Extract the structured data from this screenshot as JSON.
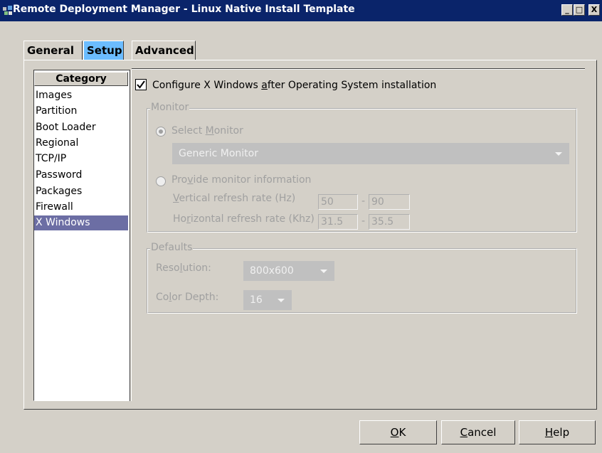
{
  "window": {
    "title": "Remote Deployment Manager - Linux Native Install Template",
    "controls": {
      "minimize": "_",
      "maximize": "□",
      "close": "X"
    }
  },
  "tabs": [
    {
      "label": "General",
      "selected": false
    },
    {
      "label": "Setup",
      "selected": true
    },
    {
      "label": "Advanced",
      "selected": false
    }
  ],
  "category": {
    "header": "Category",
    "items": [
      "Images",
      "Partition",
      "Boot Loader",
      "Regional",
      "TCP/IP",
      "Password",
      "Packages",
      "Firewall",
      "X Windows"
    ],
    "selected": "X Windows"
  },
  "xwindows": {
    "configure_checkbox": {
      "label_before": "Configure X Windows ",
      "mnemonic": "a",
      "label_after": "fter Operating System installation",
      "checked": true
    },
    "monitor": {
      "legend": "Monitor",
      "select_monitor": {
        "label_before": "Select ",
        "mnemonic": "M",
        "label_after": "onitor",
        "selected": true
      },
      "monitor_combo_value": "Generic Monitor",
      "provide_info": {
        "label_before": "Pro",
        "mnemonic": "v",
        "label_after": "ide monitor information",
        "selected": false
      },
      "vertical": {
        "label_before": "",
        "mnemonic": "V",
        "label_after": "ertical refresh rate (Hz)",
        "min": "50",
        "dash": "-",
        "max": "90"
      },
      "horizontal": {
        "label_before": "Ho",
        "mnemonic": "r",
        "label_after": "izontal refresh rate (Khz)",
        "min": "31.5",
        "dash": "-",
        "max": "35.5"
      }
    },
    "defaults": {
      "legend": "Defaults",
      "resolution": {
        "label_before": "Reso",
        "mnemonic": "l",
        "label_after": "ution:",
        "value": "800x600"
      },
      "color_depth": {
        "label_before": "Co",
        "mnemonic": "l",
        "label_after": "or Depth:",
        "value": "16"
      }
    }
  },
  "buttons": {
    "ok": {
      "mnemonic": "O",
      "rest": "K"
    },
    "cancel": {
      "mnemonic": "C",
      "rest": "ancel"
    },
    "help": {
      "mnemonic": "H",
      "rest": "elp"
    }
  }
}
